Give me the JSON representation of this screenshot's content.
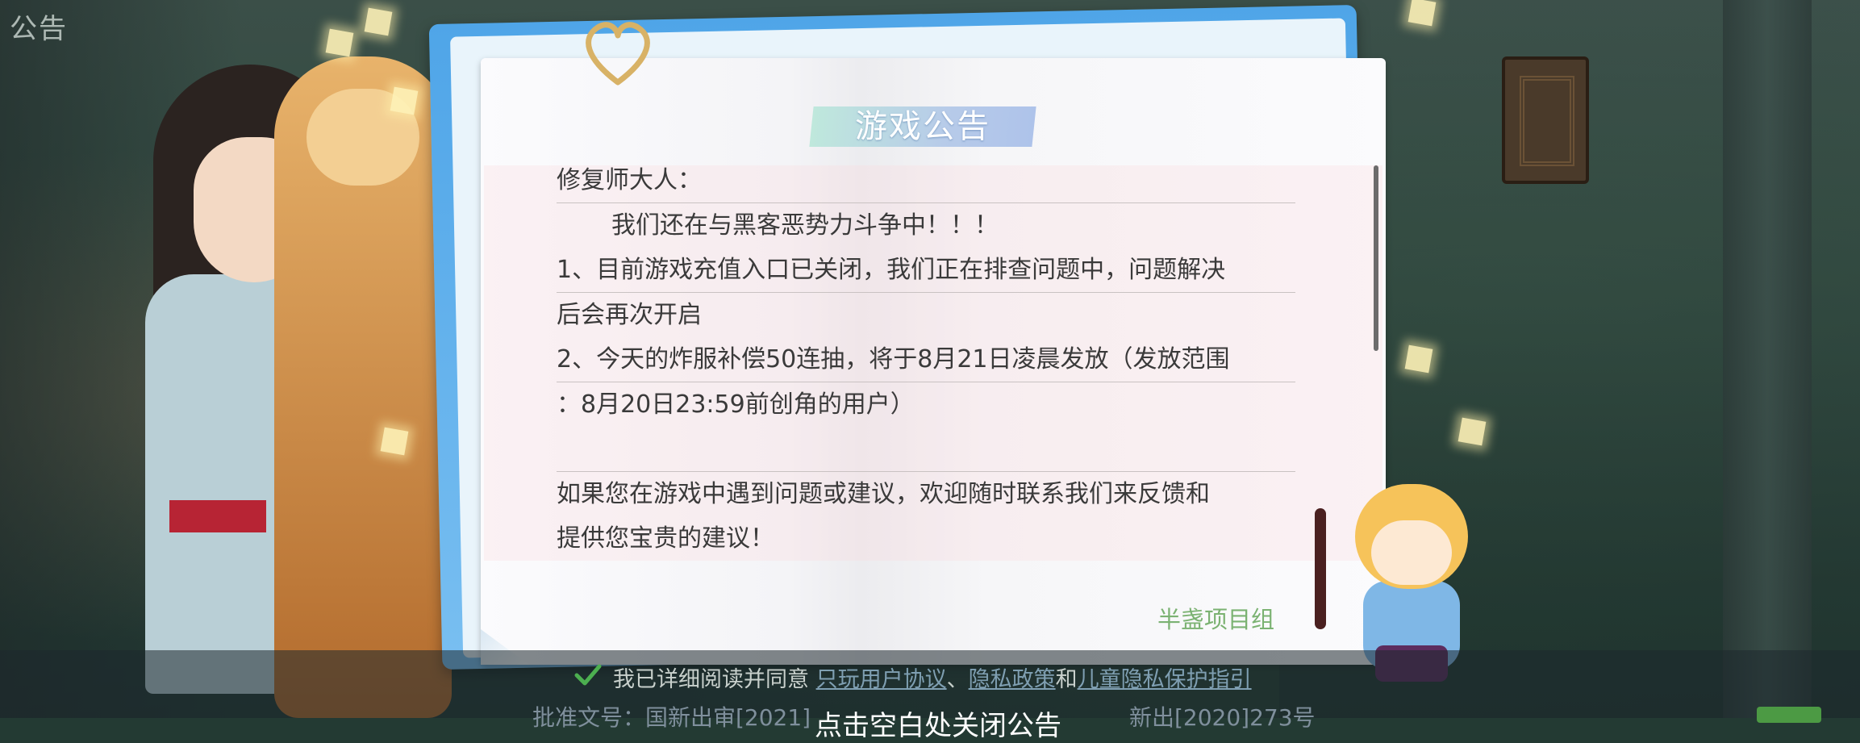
{
  "corner_label": "公告",
  "notice": {
    "title": "游戏公告",
    "lines": [
      "修复师大人：",
      "我们还在与黑客恶势力斗争中！！！",
      "1、目前游戏充值入口已关闭，我们正在排查问题中，问题解决",
      "后会再次开启",
      "2、今天的炸服补偿50连抽，将于8月21日凌晨发放（发放范围",
      "：8月20日23:59前创角的用户）",
      "",
      "如果您在游戏中遇到问题或建议，欢迎随时联系我们来反馈和",
      "提供您宝贵的建议！"
    ],
    "signature": "半盏项目组"
  },
  "footer": {
    "agree_prefix": "我已详细阅读并同意",
    "link_user_agreement": "只玩用户协议",
    "sep1": "、",
    "link_privacy": "隐私政策",
    "and": "和",
    "link_child_privacy": "儿童隐私保护指引",
    "approval_clip": "批准文号：国新出审[2021]",
    "close_tip_clip": "点击空白处关闭公告",
    "approval_clip_right": "新出[2020]273号"
  },
  "colors": {
    "title_ribbon": "#b7cbe9",
    "signature": "#7bb272",
    "dialog_frame": "#4fa5e8",
    "checkbox": "#4caf50"
  },
  "icons": {
    "heart_clip": "heart-icon",
    "checkbox": "check-icon"
  }
}
